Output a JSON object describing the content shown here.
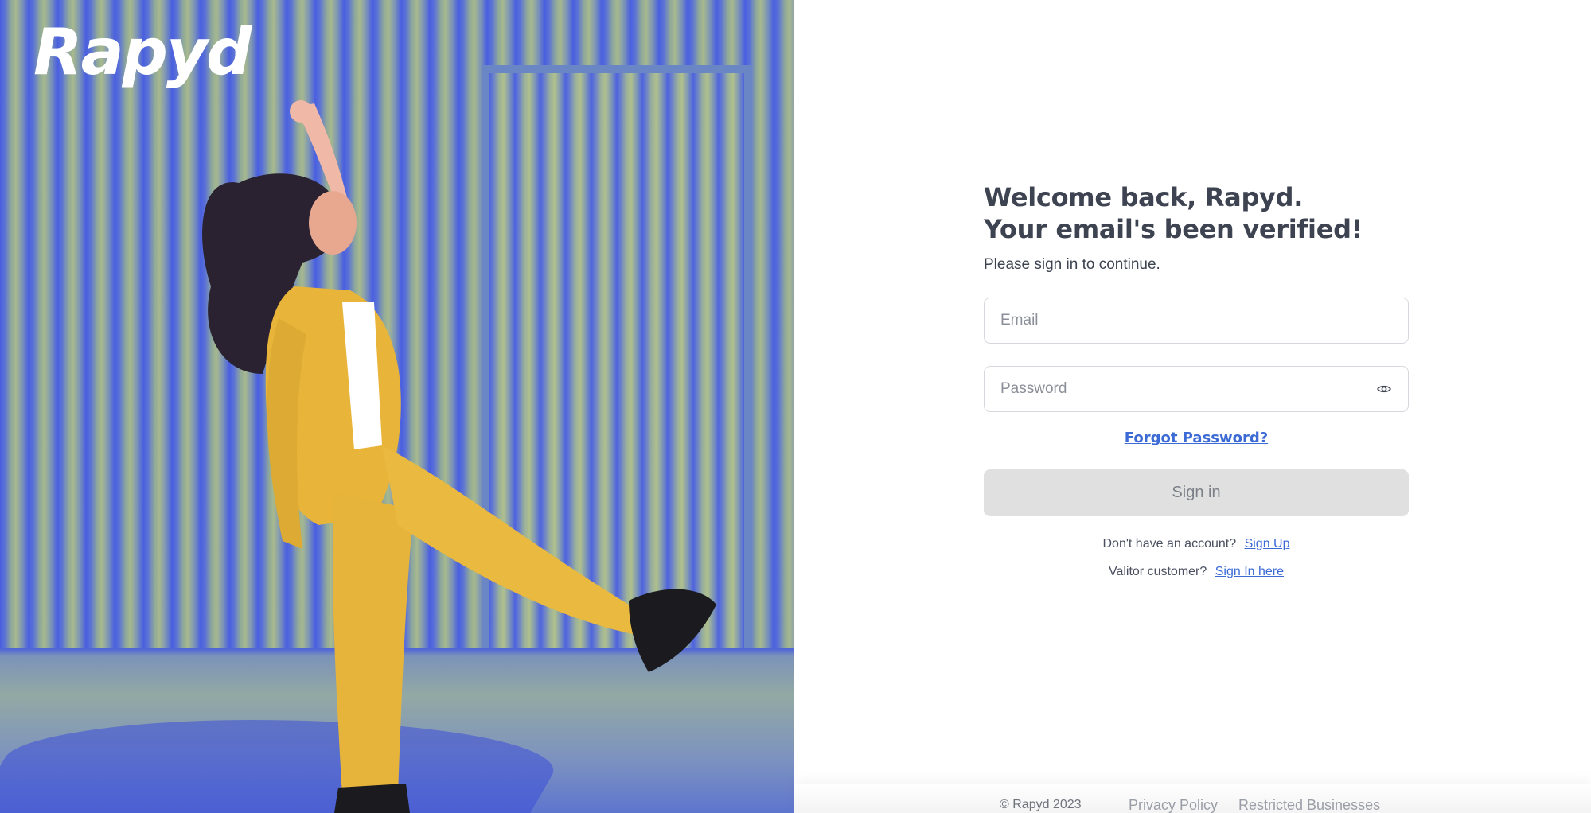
{
  "brand": {
    "logo_text": "Rapyd"
  },
  "login": {
    "heading_line1": "Welcome back, Rapyd.",
    "heading_line2": "Your email's been verified!",
    "subtitle": "Please sign in to continue.",
    "email_placeholder": "Email",
    "email_value": "",
    "password_placeholder": "Password",
    "password_value": "",
    "forgot_password_label": "Forgot Password?",
    "sign_in_label": "Sign in",
    "no_account_text": "Don't have an account?",
    "sign_up_label": "Sign Up",
    "valitor_text": "Valitor customer?",
    "valitor_sign_in_label": "Sign In here"
  },
  "icons": {
    "password_toggle": "eye-icon"
  },
  "colors": {
    "link": "#3c6bd6",
    "heading": "#3d4350",
    "button_disabled_bg": "#e0e0e0",
    "hero_blue": "#4a5fe0",
    "hero_yellow": "#e8b53a"
  },
  "footer": {
    "copyright": "© Rapyd 2023",
    "privacy_label": "Privacy Policy",
    "restricted_label": "Restricted Businesses"
  }
}
